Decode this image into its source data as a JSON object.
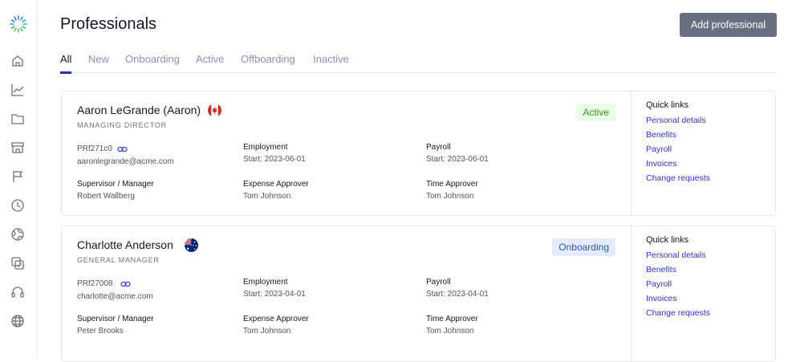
{
  "header": {
    "title": "Professionals",
    "add_button": "Add professional"
  },
  "tabs": [
    {
      "label": "All",
      "active": true
    },
    {
      "label": "New"
    },
    {
      "label": "Onboarding"
    },
    {
      "label": "Active"
    },
    {
      "label": "Offboarding"
    },
    {
      "label": "Inactive"
    }
  ],
  "sidebar": {
    "icons": [
      "home-icon",
      "chart-icon",
      "folder-icon",
      "store-icon",
      "flag-icon",
      "clock-icon",
      "globe-chart-icon",
      "documents-icon",
      "headset-icon",
      "globe-icon"
    ]
  },
  "labels": {
    "employment": "Employment",
    "payroll": "Payroll",
    "supervisor": "Supervisor / Manager",
    "expense": "Expense Approver",
    "time": "Time Approver",
    "quick_links": "Quick links"
  },
  "quick_links": [
    "Personal details",
    "Benefits",
    "Payroll",
    "Invoices",
    "Change requests"
  ],
  "professionals": [
    {
      "name": "Aaron LeGrande (Aaron)",
      "flag": "canada-flag-icon",
      "role": "MANAGING DIRECTOR",
      "status": "Active",
      "id": "PRf271c0",
      "email": "aaronlegrande@acme.com",
      "employment_start": "Start: 2023-06-01",
      "payroll_start": "Start: 2023-06-01",
      "supervisor": "Robert Wallberg",
      "expense_approver": "Tom Johnson",
      "time_approver": "Tom Johnson"
    },
    {
      "name": "Charlotte Anderson",
      "flag": "australia-flag-icon",
      "role": "GENERAL MANAGER",
      "status": "Onboarding",
      "id": "PRf27008",
      "email": "charlotte@acme.com",
      "employment_start": "Start: 2023-04-01",
      "payroll_start": "Start: 2023-04-01",
      "supervisor": "Peter Brooks",
      "expense_approver": "Tom Johnson",
      "time_approver": "Tom Johnson"
    }
  ],
  "colors": {
    "accent": "#2330c8",
    "button": "#667080",
    "link": "#2e31d8"
  }
}
